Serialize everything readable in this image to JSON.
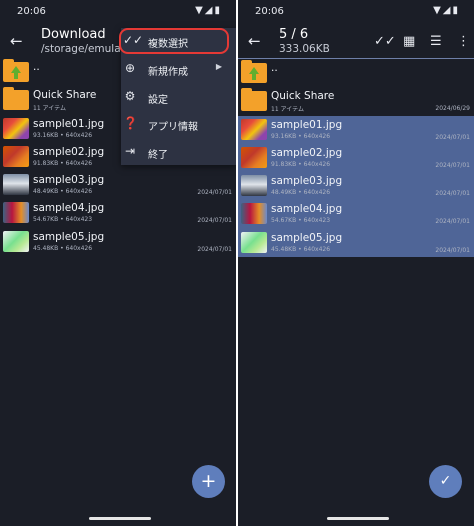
{
  "left": {
    "status": {
      "time": "20:06",
      "icons": "▼◢▮"
    },
    "appbar": {
      "title": "Download",
      "subtitle": "/storage/emulated/"
    },
    "menu": {
      "items": [
        {
          "icon": "✓✓",
          "label": "複数選択",
          "highlighted": true
        },
        {
          "icon": "⊕",
          "label": "新規作成",
          "caret": "▶"
        },
        {
          "icon": "⚙",
          "label": "設定"
        },
        {
          "icon": "❓",
          "label": "アプリ情報"
        },
        {
          "icon": "⇥",
          "label": "終了"
        }
      ]
    },
    "files": [
      {
        "type": "parent",
        "name": ".."
      },
      {
        "type": "folder",
        "name": "Quick Share",
        "meta": "11 アイテム",
        "date": ""
      },
      {
        "type": "image",
        "name": "sample01.jpg",
        "meta": "93.16KB  •  640x426",
        "date": ""
      },
      {
        "type": "image",
        "name": "sample02.jpg",
        "meta": "91.83KB  •  640x426",
        "date": ""
      },
      {
        "type": "image",
        "name": "sample03.jpg",
        "meta": "48.49KB  •  640x426",
        "date": "2024/07/01"
      },
      {
        "type": "image",
        "name": "sample04.jpg",
        "meta": "54.67KB  •  640x423",
        "date": "2024/07/01"
      },
      {
        "type": "image",
        "name": "sample05.jpg",
        "meta": "45.48KB  •  640x426",
        "date": "2024/07/01"
      }
    ],
    "fab_icon": "+"
  },
  "right": {
    "status": {
      "time": "20:06",
      "icons": "▼◢▮"
    },
    "appbar": {
      "title": "5 / 6",
      "subtitle": "333.06KB"
    },
    "toolbar": {
      "select_all": "✓✓",
      "grid": "▦",
      "list": "☰",
      "more": "⋮"
    },
    "files": [
      {
        "type": "parent",
        "name": "..",
        "selected": false
      },
      {
        "type": "folder",
        "name": "Quick Share",
        "meta": "11 アイテム",
        "date": "2024/06/29",
        "selected": false
      },
      {
        "type": "image",
        "name": "sample01.jpg",
        "meta": "93.16KB  •  640x426",
        "date": "2024/07/01",
        "selected": true
      },
      {
        "type": "image",
        "name": "sample02.jpg",
        "meta": "91.83KB  •  640x426",
        "date": "2024/07/01",
        "selected": true
      },
      {
        "type": "image",
        "name": "sample03.jpg",
        "meta": "48.49KB  •  640x426",
        "date": "2024/07/01",
        "selected": true
      },
      {
        "type": "image",
        "name": "sample04.jpg",
        "meta": "54.67KB  •  640x423",
        "date": "2024/07/01",
        "selected": true
      },
      {
        "type": "image",
        "name": "sample05.jpg",
        "meta": "45.48KB  •  640x426",
        "date": "2024/07/01",
        "selected": true
      }
    ],
    "fab_icon": "✓"
  },
  "colors": {
    "background": "#1b1e27",
    "selection": "#4f6597",
    "fab": "#5f7ebc",
    "menu": "#2d3242",
    "highlight": "#e53935",
    "folder": "#f3a12a"
  }
}
